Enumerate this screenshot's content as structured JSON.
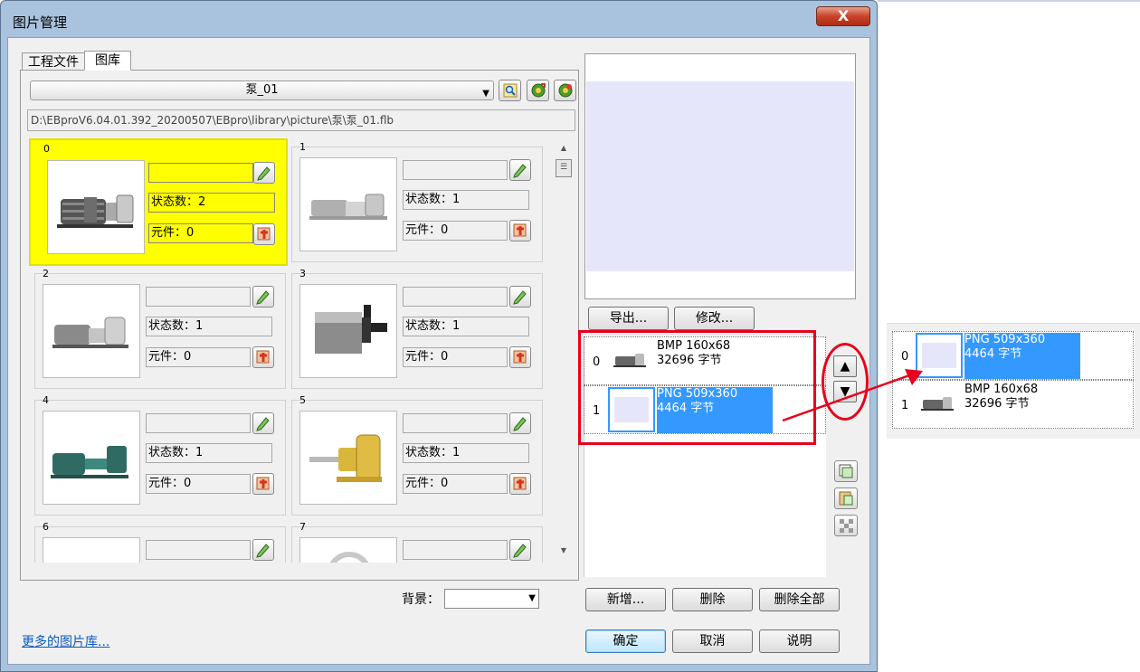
{
  "window": {
    "title": "图片管理",
    "close_glyph": "X"
  },
  "tabs": [
    {
      "label": "工程文件"
    },
    {
      "label": "图库"
    }
  ],
  "library": {
    "selected": "泵_01",
    "path": "D:\\EBproV6.04.01.392_20200507\\EBpro\\library\\picture\\泵\\泵_01.flb"
  },
  "cells": [
    {
      "index": "0",
      "name": "",
      "states": "状态数：2",
      "parts": "元件：0",
      "selected": true
    },
    {
      "index": "1",
      "name": "",
      "states": "状态数：1",
      "parts": "元件：0"
    },
    {
      "index": "2",
      "name": "",
      "states": "状态数：1",
      "parts": "元件：0"
    },
    {
      "index": "3",
      "name": "",
      "states": "状态数：1",
      "parts": "元件：0"
    },
    {
      "index": "4",
      "name": "",
      "states": "状态数：1",
      "parts": "元件：0"
    },
    {
      "index": "5",
      "name": "",
      "states": "状态数：1",
      "parts": "元件：0"
    },
    {
      "index": "6",
      "name": ""
    },
    {
      "index": "7",
      "name": ""
    }
  ],
  "background": {
    "label": "背景：",
    "value": ""
  },
  "more_link": "更多的图片库...",
  "preview_buttons": {
    "export": "导出...",
    "modify": "修改..."
  },
  "state_list": [
    {
      "num": "0",
      "line1": "BMP 160x68",
      "line2": "32696 字节",
      "selected": false
    },
    {
      "num": "1",
      "line1": "PNG 509x360",
      "line2": "4464 字节",
      "selected": true
    }
  ],
  "reordered_list": [
    {
      "num": "0",
      "line1": "PNG 509x360",
      "line2": "4464 字节",
      "selected": true
    },
    {
      "num": "1",
      "line1": "BMP 160x68",
      "line2": "32696 字节",
      "selected": false
    }
  ],
  "list_buttons": {
    "add": "新增...",
    "delete": "删除",
    "delete_all": "删除全部"
  },
  "dialog_buttons": {
    "ok": "确定",
    "cancel": "取消",
    "help": "说明"
  },
  "icons": {
    "move_up": "▲",
    "move_down": "▼"
  },
  "colors": {
    "selected_cell": "#ffff00",
    "selection_blue": "#3399ff",
    "annotation_red": "#e8001c",
    "preview_bg": "#e6e6fa"
  }
}
